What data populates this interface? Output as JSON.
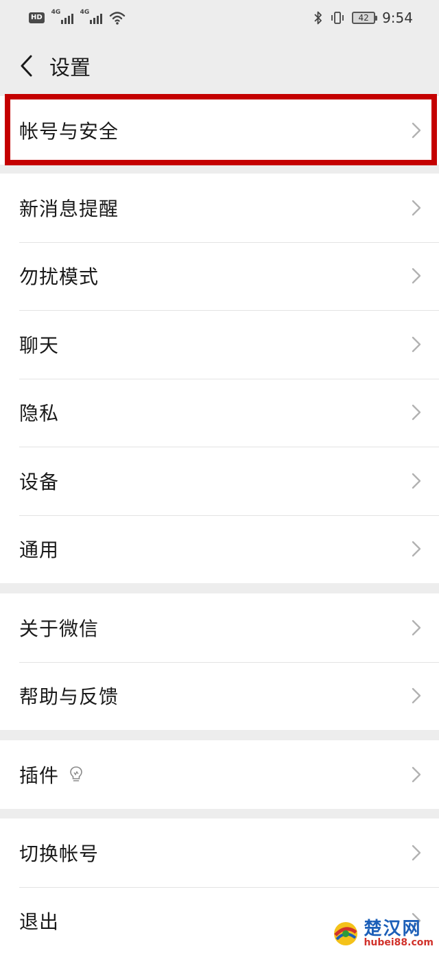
{
  "status_bar": {
    "hd": "HD",
    "signal1_tag": "4G",
    "signal2_tag": "4G",
    "battery": "42",
    "time": "9:54"
  },
  "nav": {
    "title": "设置"
  },
  "groups": [
    {
      "items": [
        {
          "label": "帐号与安全"
        }
      ]
    },
    {
      "items": [
        {
          "label": "新消息提醒"
        },
        {
          "label": "勿扰模式"
        },
        {
          "label": "聊天"
        },
        {
          "label": "隐私"
        },
        {
          "label": "设备"
        },
        {
          "label": "通用"
        }
      ]
    },
    {
      "items": [
        {
          "label": "关于微信"
        },
        {
          "label": "帮助与反馈"
        }
      ]
    },
    {
      "items": [
        {
          "label": "插件"
        }
      ]
    },
    {
      "items": [
        {
          "label": "切换帐号"
        },
        {
          "label": "退出"
        }
      ]
    }
  ],
  "watermark": {
    "title": "楚汉网",
    "url": "hubei88.com"
  },
  "colors": {
    "highlight": "#c40000",
    "background": "#ededed"
  }
}
